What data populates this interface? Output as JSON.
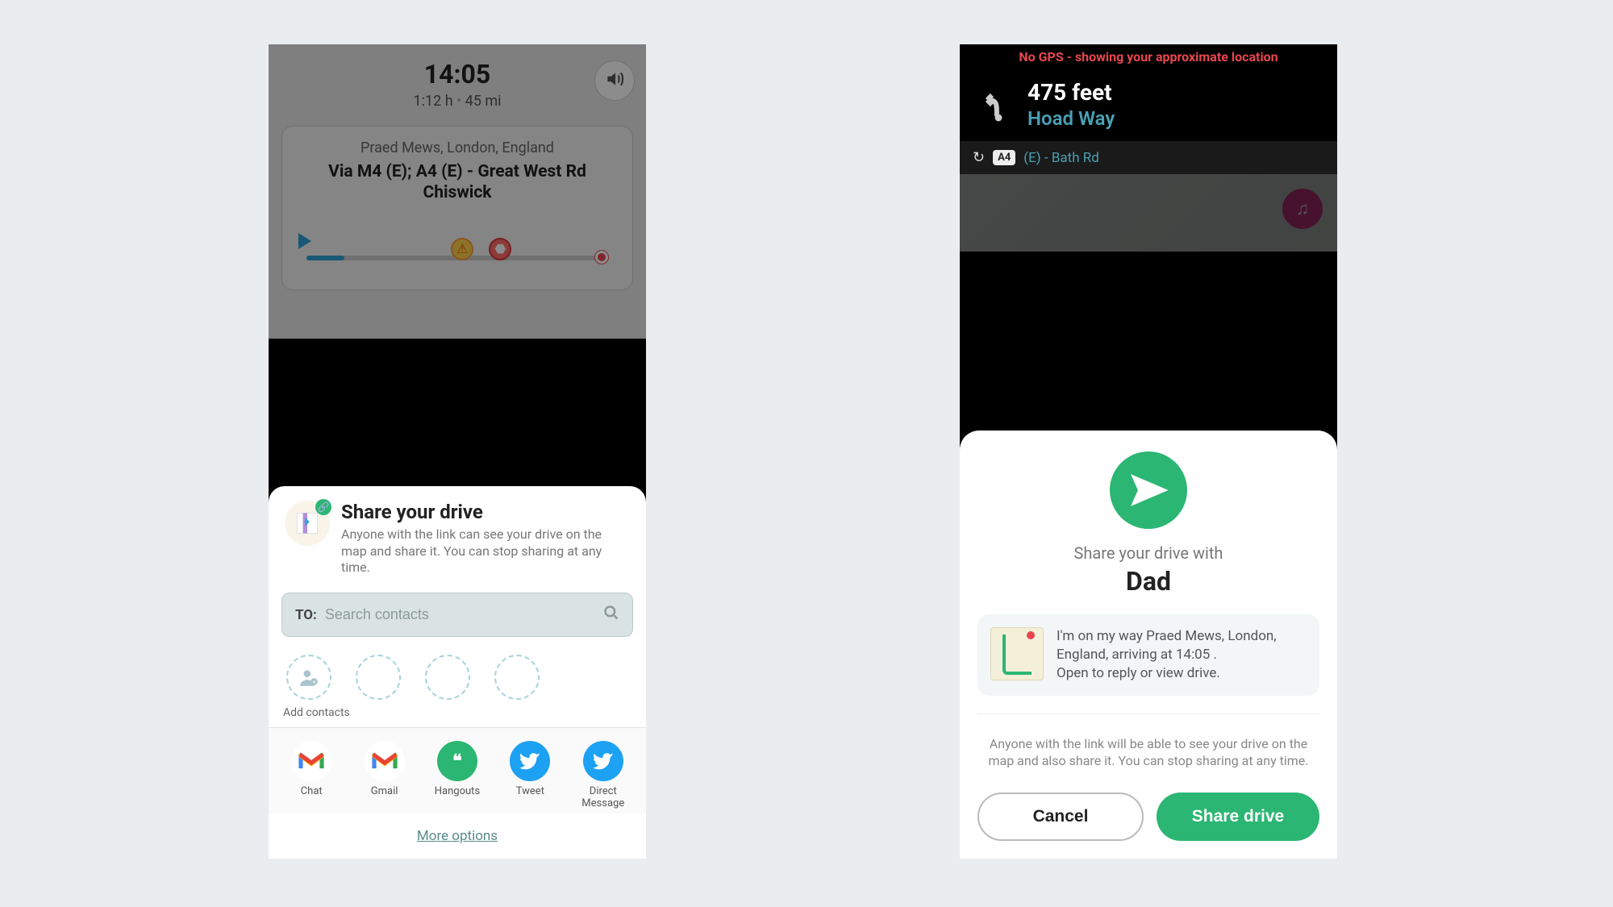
{
  "left": {
    "arrival_time": "14:05",
    "duration": "1:12 h",
    "distance": "45 mi",
    "destination": "Praed Mews, London, England",
    "via": "Via M4 (E); A4 (E) - Great West Rd Chiswick",
    "sound_icon": "sound-icon",
    "share": {
      "title": "Share your drive",
      "description": "Anyone with the link can see your drive on the map and share it. You can stop sharing at any time.",
      "search_label": "TO:",
      "search_placeholder": "Search contacts",
      "add_contacts_label": "Add contacts",
      "apps": [
        {
          "id": "chat",
          "label": "Chat"
        },
        {
          "id": "gmail",
          "label": "Gmail"
        },
        {
          "id": "hangouts",
          "label": "Hangouts"
        },
        {
          "id": "tweet",
          "label": "Tweet"
        },
        {
          "id": "dm",
          "label": "Direct Message"
        }
      ],
      "more_options": "More options"
    }
  },
  "right": {
    "gps_warning": "No GPS - showing your approximate location",
    "next_distance": "475 feet",
    "next_road": "Hoad Way",
    "following_road_badge": "A4",
    "following_road": "(E) - Bath Rd",
    "confirm": {
      "share_with_label": "Share your drive with",
      "recipient": "Dad",
      "message_line1": "I'm on my way Praed Mews, London, England, arriving at 14:05 .",
      "message_line2": "Open to reply or view drive.",
      "disclaimer": "Anyone with the link will be able to see your drive on the map and also share it. You can stop sharing at any time.",
      "cancel": "Cancel",
      "confirm": "Share drive"
    }
  }
}
